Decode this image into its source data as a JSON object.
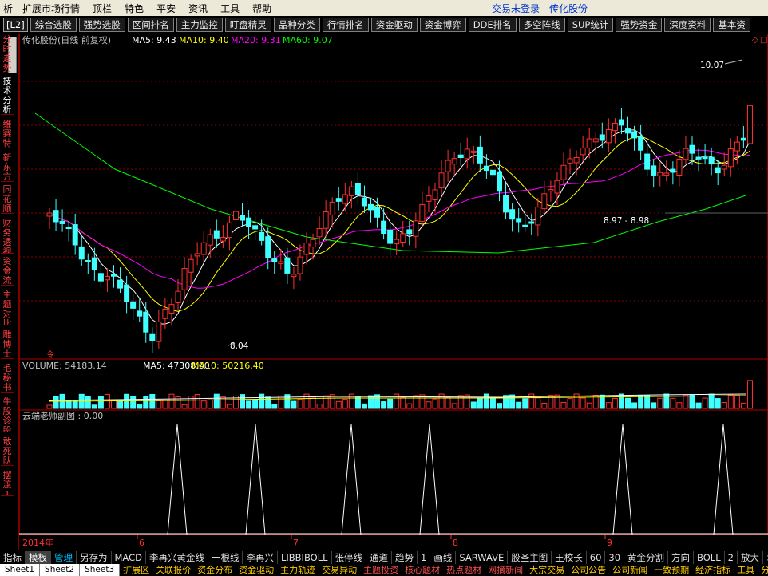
{
  "menu": {
    "items": [
      "扩展市场行情",
      "顶栏",
      "特色",
      "平安",
      "资讯",
      "工具",
      "帮助"
    ],
    "status_login": "交易未登录",
    "status_stock": "传化股份",
    "leading": "析"
  },
  "toolbar": {
    "items": [
      "[L2]",
      "综合选股",
      "强势选股",
      "区间排名",
      "主力监控",
      "盯盘精灵",
      "品种分类",
      "行情排名",
      "资金驱动",
      "资金博弈",
      "DDE排名",
      "多空阵线",
      "SUP统计",
      "强势资金",
      "深度资料",
      "基本资"
    ]
  },
  "left_tabs": [
    "分时走势",
    "技术分析",
    "维赛特",
    "新东方",
    "同花顺",
    "财务透视",
    "资金流",
    "主题对比",
    "雕博士",
    "毛秘书",
    "牛股诊股",
    "敢死队",
    "摆渡1"
  ],
  "colors": {
    "ma5": "#ffffff",
    "ma10": "#ffff00",
    "ma20": "#ff00ff",
    "ma60": "#00ff00",
    "up": "#ff3030",
    "down": "#40ffff",
    "grid": "#8b0000"
  },
  "main_panel": {
    "title": "传化股份(日线 前复权)",
    "ma5_label": "MA5: 9.43",
    "ma10_label": "MA10: 9.40",
    "ma20_label": "MA20: 9.31",
    "ma60_label": "MA60: 9.07",
    "high_marker": "10.07",
    "low_marker": "8.04",
    "range_marker": "8.97 - 8.98",
    "flag": "令"
  },
  "volume_panel": {
    "label_volume": "VOLUME: 54183.14",
    "label_ma5": "MA5: 47308.60",
    "label_ma10": "MA10: 50216.40"
  },
  "sub_panel": {
    "title": "云端老师副图 : 0.00"
  },
  "x_axis": {
    "year": "2014年",
    "months": [
      "6",
      "7",
      "8",
      "9"
    ]
  },
  "bottom_tabs": [
    "指标",
    "模板",
    "管理",
    "另存为",
    "MACD",
    "李再兴黄金线",
    "一根线",
    "李再兴",
    "LIBBIBOLL",
    "张停线",
    "通道",
    "趋势",
    "1",
    "画线",
    "SARWAVE",
    "股圣主图",
    "王校长",
    "60",
    "30",
    "黄金分割",
    "方向",
    "BOLL",
    "2",
    "放大",
    ">>"
  ],
  "bottom_active": "管理",
  "bottom_selected": "模板",
  "sheet_tabs": [
    "Sheet1",
    "Sheet2",
    "Sheet3"
  ],
  "info_tabs": [
    "扩展区",
    "关联报价",
    "资金分布",
    "资金驱动",
    "主力轨迹",
    "交易异动",
    "主题投资",
    "核心题材",
    "热点题材",
    "网摘新闻",
    "大宗交易",
    "公司公告",
    "公司新闻",
    "一致预期",
    "经济指标",
    "工具",
    "分时明细"
  ]
}
